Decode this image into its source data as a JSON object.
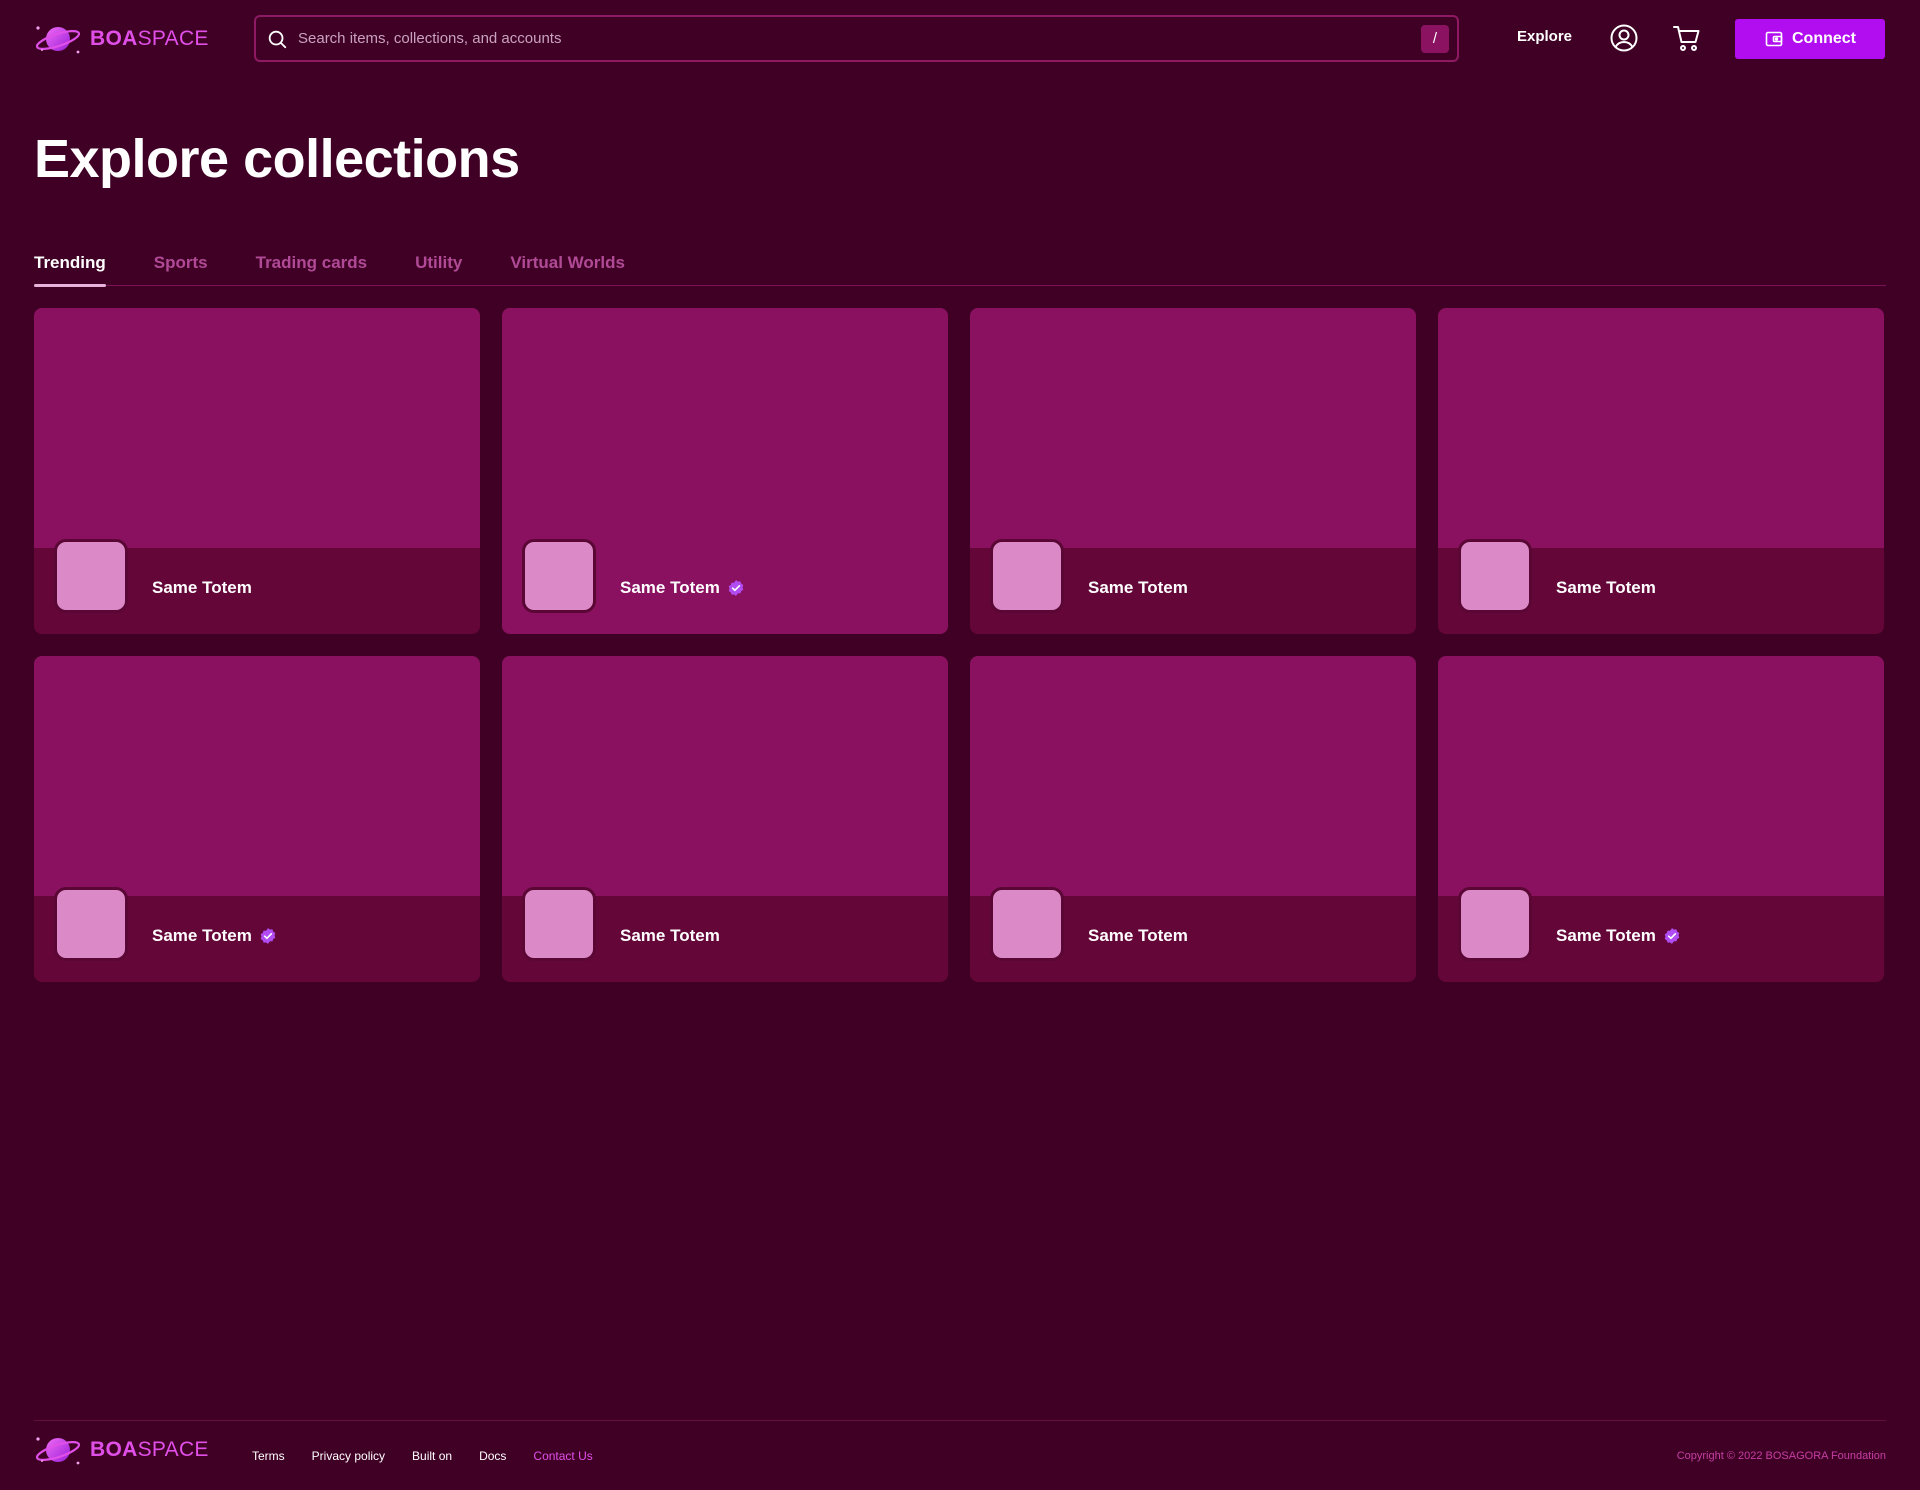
{
  "brand": {
    "name_bold": "BOA",
    "name_light": "SPACE"
  },
  "colors": {
    "background": "#400025",
    "card_banner": "#891160",
    "card_footer": "#640638",
    "thumb": "#dc8ac7",
    "accent": "#b10df0",
    "verified": "#b04cf2"
  },
  "search": {
    "placeholder": "Search items, collections, and accounts",
    "value": "",
    "shortcut": "/",
    "icon": "search-icon"
  },
  "nav": {
    "explore_label": "Explore",
    "account_icon": "user-circle-icon",
    "cart_icon": "shopping-cart-icon",
    "connect_label": "Connect",
    "connect_icon": "wallet-icon"
  },
  "page": {
    "title": "Explore collections"
  },
  "tabs": [
    {
      "label": "Trending",
      "active": true
    },
    {
      "label": "Sports",
      "active": false
    },
    {
      "label": "Trading cards",
      "active": false
    },
    {
      "label": "Utility",
      "active": false
    },
    {
      "label": "Virtual Worlds",
      "active": false
    }
  ],
  "collections": [
    {
      "name": "Same Totem",
      "verified": false
    },
    {
      "name": "Same Totem",
      "verified": true
    },
    {
      "name": "Same Totem",
      "verified": false
    },
    {
      "name": "Same Totem",
      "verified": false
    },
    {
      "name": "Same Totem",
      "verified": true
    },
    {
      "name": "Same Totem",
      "verified": false
    },
    {
      "name": "Same Totem",
      "verified": false
    },
    {
      "name": "Same Totem",
      "verified": true
    }
  ],
  "footer": {
    "links": [
      {
        "label": "Terms"
      },
      {
        "label": "Privacy policy"
      },
      {
        "label": "Built on"
      },
      {
        "label": "Docs"
      },
      {
        "label": "Contact Us"
      }
    ],
    "copyright": "Copyright © 2022 BOSAGORA Foundation"
  }
}
